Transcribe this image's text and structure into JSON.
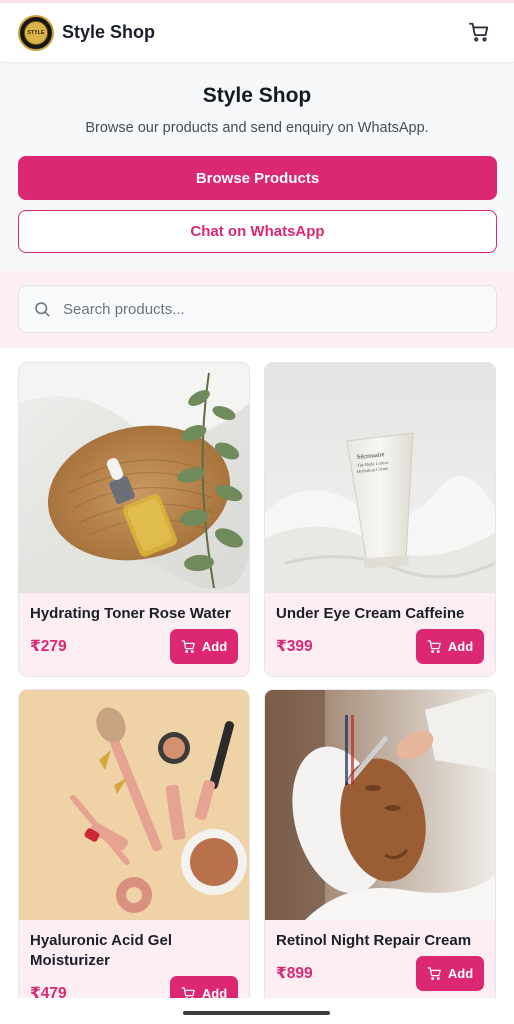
{
  "header": {
    "logo_text": "STYLE",
    "brand": "Style Shop",
    "cart_icon": "cart-icon"
  },
  "hero": {
    "title": "Style Shop",
    "subtitle": "Browse our products and send enquiry on WhatsApp.",
    "primary_button": "Browse Products",
    "secondary_button": "Chat on WhatsApp"
  },
  "search": {
    "placeholder": "Search products...",
    "icon": "search-icon"
  },
  "products": [
    {
      "name": "Hydrating Toner Rose Water",
      "price": "₹279",
      "add_label": "Add"
    },
    {
      "name": "Under Eye Cream Caffeine",
      "price": "₹399",
      "add_label": "Add"
    },
    {
      "name": "Hyaluronic Acid Gel Moisturizer",
      "price": "₹479",
      "add_label": "Add"
    },
    {
      "name": "Retinol Night Repair Cream",
      "price": "₹899",
      "add_label": "Add"
    }
  ],
  "tube_label": "Sécrouaire The Body Lotion Hydration Crème",
  "colors": {
    "accent": "#dc2773",
    "accent_light": "#fdeef4",
    "text": "#1b1f2a"
  }
}
